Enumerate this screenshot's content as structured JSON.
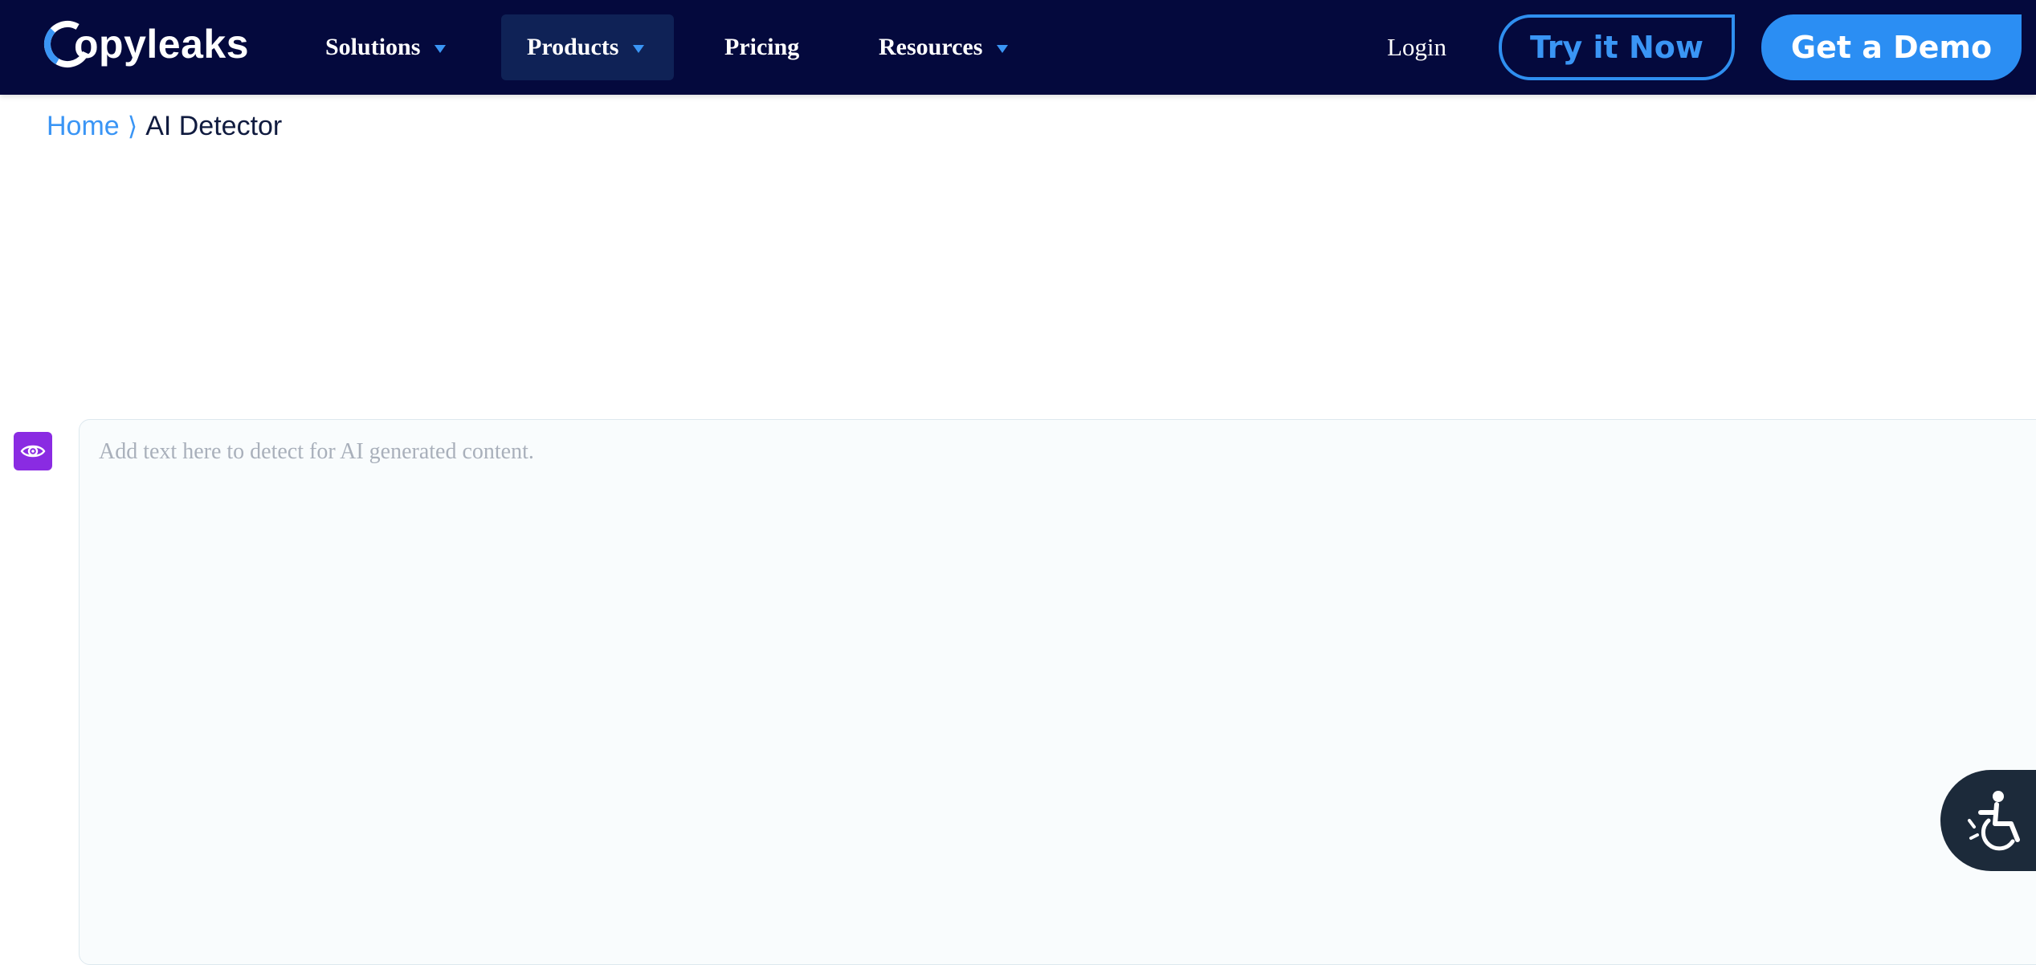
{
  "brand": {
    "name": "Copyleaks",
    "logo_text": "opyleaks",
    "logo_icon": "copyleaks-c-icon",
    "accent_color": "#3a95f5",
    "nav_bg_color": "#04093d"
  },
  "nav": {
    "items": [
      {
        "label": "Solutions",
        "has_dropdown": true
      },
      {
        "label": "Products",
        "has_dropdown": true,
        "active": true
      },
      {
        "label": "Pricing",
        "has_dropdown": false
      },
      {
        "label": "Resources",
        "has_dropdown": true
      }
    ],
    "login_label": "Login",
    "try_label": "Try it Now",
    "demo_label": "Get a Demo"
  },
  "breadcrumb": {
    "home": "Home",
    "separator": "⟩",
    "current": "AI Detector"
  },
  "editor": {
    "placeholder": "Add text here to detect for AI generated content.",
    "value": "",
    "side_icon": "eye-icon",
    "side_icon_color": "#8a2be2"
  },
  "accessibility": {
    "icon": "accessibility-wheelchair-icon"
  }
}
